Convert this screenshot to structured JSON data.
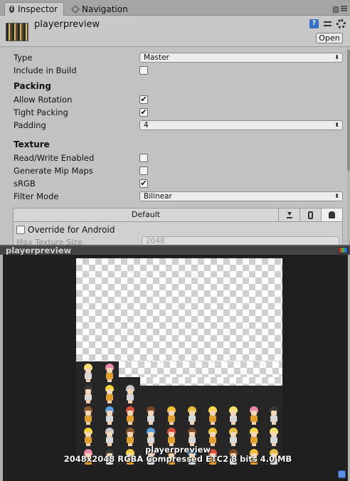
{
  "tabs": [
    {
      "label": "Inspector",
      "icon": "info-icon",
      "active": true
    },
    {
      "label": "Navigation",
      "icon": "navigation-icon",
      "active": false
    }
  ],
  "header": {
    "title": "playerpreview",
    "open_label": "Open",
    "icons": [
      "help-icon",
      "preset-sliders-icon",
      "gear-icon"
    ]
  },
  "fields": {
    "type": {
      "label": "Type",
      "value": "Master"
    },
    "include_in_build": {
      "label": "Include in Build",
      "checked": false
    },
    "packing_section": "Packing",
    "allow_rotation": {
      "label": "Allow Rotation",
      "checked": true
    },
    "tight_packing": {
      "label": "Tight Packing",
      "checked": true
    },
    "padding": {
      "label": "Padding",
      "value": "4"
    },
    "texture_section": "Texture",
    "read_write": {
      "label": "Read/Write Enabled",
      "checked": false
    },
    "generate_mip": {
      "label": "Generate Mip Maps",
      "checked": false
    },
    "srgb": {
      "label": "sRGB",
      "checked": true
    },
    "filter_mode": {
      "label": "Filter Mode",
      "value": "Bilinear"
    }
  },
  "platform": {
    "default_label": "Default",
    "buttons": [
      "download-icon",
      "phone-icon",
      "android-icon"
    ],
    "override_label": "Override for Android",
    "max_size_label": "Max Texture Size",
    "max_size_value": "2048"
  },
  "preview": {
    "title": "playerpreview",
    "name": "playerpreview",
    "info": "2048x2048 RGBA Compressed ETC2 8 bits   4.0 MB"
  },
  "check_glyph": "✔",
  "arrow_glyph": "⬍"
}
